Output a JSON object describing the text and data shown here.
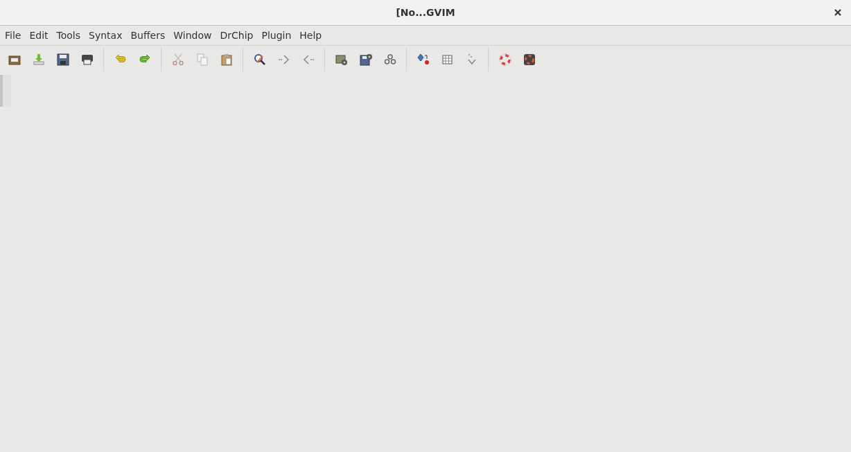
{
  "window": {
    "title": "[No...GVIM"
  },
  "menu": [
    "File",
    "Edit",
    "Tools",
    "Syntax",
    "Buffers",
    "Window",
    "DrChip",
    "Plugin",
    "Help"
  ],
  "toolbar": [
    [
      {
        "kind": "open",
        "disabled": false
      },
      {
        "kind": "download",
        "disabled": false
      },
      {
        "kind": "save",
        "disabled": false
      },
      {
        "kind": "print",
        "disabled": false
      }
    ],
    [
      {
        "kind": "undo",
        "disabled": false
      },
      {
        "kind": "redo",
        "disabled": false
      }
    ],
    [
      {
        "kind": "cut",
        "disabled": true
      },
      {
        "kind": "copy",
        "disabled": true
      },
      {
        "kind": "paste",
        "disabled": false
      }
    ],
    [
      {
        "kind": "find",
        "disabled": false
      },
      {
        "kind": "next",
        "disabled": false
      },
      {
        "kind": "prev",
        "disabled": false
      }
    ],
    [
      {
        "kind": "folder-gear",
        "disabled": false
      },
      {
        "kind": "save-gear",
        "disabled": false
      },
      {
        "kind": "gears",
        "disabled": false
      }
    ],
    [
      {
        "kind": "diamond",
        "disabled": false
      },
      {
        "kind": "grid",
        "disabled": false
      },
      {
        "kind": "down",
        "disabled": false
      }
    ],
    [
      {
        "kind": "help",
        "disabled": false
      },
      {
        "kind": "help-dark",
        "disabled": false
      }
    ]
  ]
}
